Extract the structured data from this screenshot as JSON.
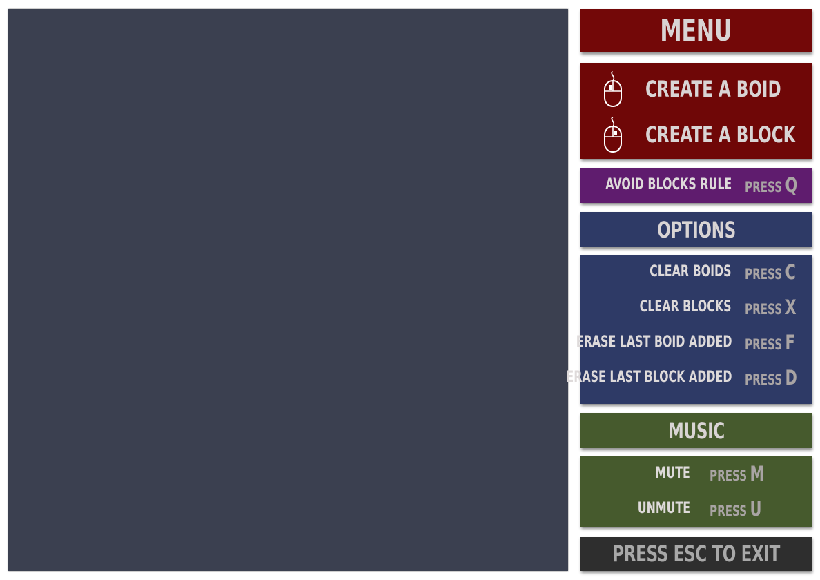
{
  "menu": {
    "title": "MENU",
    "mouse_actions": [
      {
        "label": "CREATE A BOID",
        "icon": "mouse-left-click-icon"
      },
      {
        "label": "CREATE A BLOCK",
        "icon": "mouse-right-click-icon"
      }
    ]
  },
  "rule": {
    "label": "AVOID BLOCKS RULE",
    "press": "PRESS",
    "key": "Q"
  },
  "options": {
    "title": "OPTIONS",
    "items": [
      {
        "label": "CLEAR BOIDS",
        "press": "PRESS",
        "key": "C"
      },
      {
        "label": "CLEAR BLOCKS",
        "press": "PRESS",
        "key": "X"
      },
      {
        "label": "ERASE LAST BOID ADDED",
        "press": "PRESS",
        "key": "F"
      },
      {
        "label": "ERASE LAST BLOCK ADDED",
        "press": "PRESS",
        "key": "D"
      }
    ]
  },
  "music": {
    "title": "MUSIC",
    "items": [
      {
        "label": "MUTE",
        "press": "PRESS",
        "key": "M"
      },
      {
        "label": "UNMUTE",
        "press": "PRESS",
        "key": "U"
      }
    ]
  },
  "exit": {
    "label": "PRESS ESC TO EXIT"
  },
  "colors": {
    "canvas": "#3b4050",
    "menu": "#730808",
    "rule": "#5f1c6e",
    "options": "#2e3a66",
    "music": "#465a2d",
    "exit": "#2e2e2e",
    "text": "#d9d4d4",
    "press_text": "#a9a4a4"
  }
}
